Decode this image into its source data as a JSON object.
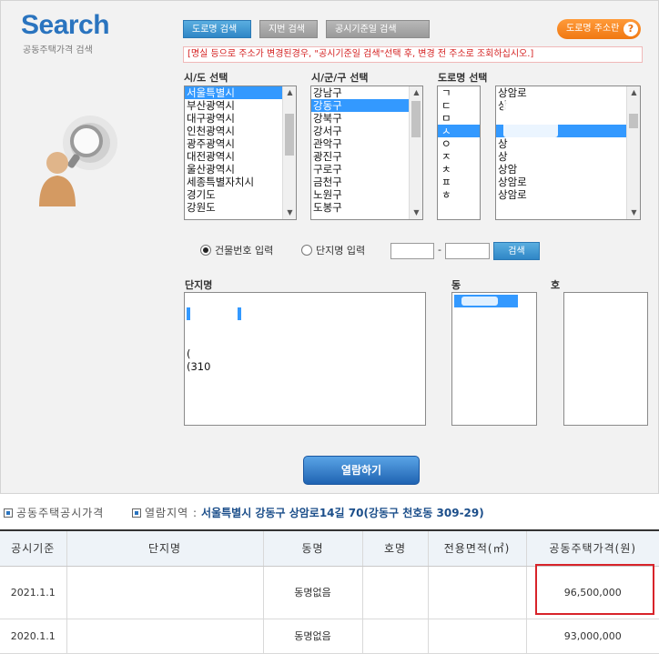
{
  "brand": {
    "title": "Search",
    "subtitle": "공동주택가격 검색"
  },
  "mode_tabs": [
    "도로명 검색",
    "지번 검색",
    "공시기준일 검색"
  ],
  "road_help": {
    "label": "도로명 주소란",
    "icon": "question-icon"
  },
  "notice": "[명실 등으로 주소가 변경된경우, \"공시기준일 검색\"선택 후, 변경 전 주소로 조회하십시오.]",
  "sido": {
    "label": "시/도 선택",
    "items": [
      "서울특별시",
      "부산광역시",
      "대구광역시",
      "인천광역시",
      "광주광역시",
      "대전광역시",
      "울산광역시",
      "세종특별자치시",
      "경기도",
      "강원도"
    ],
    "selected": "서울특별시"
  },
  "sigungu": {
    "label": "시/군/구 선택",
    "items": [
      "강남구",
      "강동구",
      "강북구",
      "강서구",
      "관악구",
      "광진구",
      "구로구",
      "금천구",
      "노원구",
      "도봉구"
    ],
    "selected": "강동구"
  },
  "road": {
    "label": "도로명 선택",
    "initials": [
      "ㄱ",
      "ㄷ",
      "ㅁ",
      "ㅅ",
      "ㅇ",
      "ㅈ",
      "ㅊ",
      "ㅍ",
      "ㅎ"
    ],
    "selected_initial": "ㅅ",
    "names": [
      "상암로",
      "상",
      "",
      "",
      "상",
      "상",
      "상암",
      "상암로",
      "상암로"
    ],
    "selected_index": 3
  },
  "input_mode": {
    "options": [
      "건물번호 입력",
      "단지명 입력"
    ],
    "selected": "건물번호 입력",
    "number_main": "",
    "number_sub": "",
    "dash": "-",
    "search_label": "검색"
  },
  "complex": {
    "label": "단지명",
    "items": [
      "",
      "",
      "",
      "(",
      "(310"
    ]
  },
  "dong": {
    "label": "동"
  },
  "ho": {
    "label": "호"
  },
  "view_button": "열람하기",
  "result": {
    "section_title": "공동주택공시가격",
    "region_label": "열람지역 :",
    "region_value": "서울특별시 강동구 상암로14길 70(강동구 천호동 309-29)",
    "columns": [
      "공시기준",
      "단지명",
      "동명",
      "호명",
      "전용면적(㎡)",
      "공동주택가격(원)"
    ],
    "rows": [
      {
        "date": "2021.1.1",
        "complex": "",
        "dong": "동명없음",
        "ho": "",
        "area": "",
        "price": "96,500,000"
      },
      {
        "date": "2020.1.1",
        "complex": "",
        "dong": "동명없음",
        "ho": "",
        "area": "",
        "price": "93,000,000"
      }
    ]
  },
  "colors": {
    "brand_blue": "#2a74bf",
    "select_blue": "#3399ff",
    "help_orange": "#f07812",
    "highlight_red": "#d8232a",
    "notice_red": "#d42020"
  }
}
